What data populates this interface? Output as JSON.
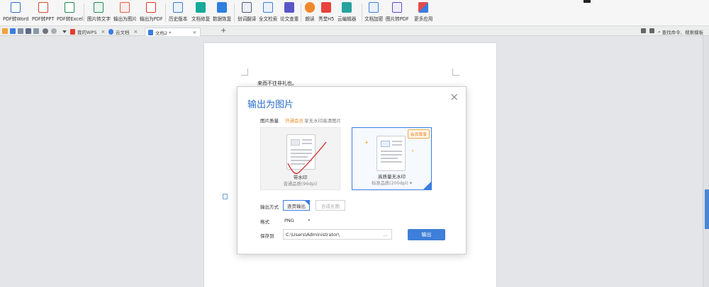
{
  "ribbon": {
    "buttons": [
      {
        "label": "PDF转Word",
        "icon": "pdf-to-word-icon",
        "color": "#2b6fc2"
      },
      {
        "label": "PDF转PPT",
        "icon": "pdf-to-ppt-icon",
        "color": "#d24726"
      },
      {
        "label": "PDF转Excel",
        "icon": "pdf-to-excel-icon",
        "color": "#1e8a4c"
      },
      {
        "label": "图片转文字",
        "icon": "image-to-text-icon",
        "color": "#2b8a5a"
      },
      {
        "label": "输出为图片",
        "icon": "export-image-icon",
        "color": "#e25b45"
      },
      {
        "label": "输出为PDF",
        "icon": "export-pdf-icon",
        "color": "#d93a2b"
      },
      {
        "label": "历史版本",
        "icon": "history-icon",
        "color": "#3a78d4"
      },
      {
        "label": "文档修复",
        "icon": "doc-repair-icon",
        "color": "#17a99a"
      },
      {
        "label": "数据恢复",
        "icon": "data-recovery-icon",
        "color": "#2f7fe0"
      },
      {
        "label": "划词翻译",
        "icon": "translate-icon",
        "color": "#4c5a7a"
      },
      {
        "label": "全文检索",
        "icon": "fulltext-search-icon",
        "color": "#3b7de0"
      },
      {
        "label": "论文查重",
        "icon": "plagiarism-check-icon",
        "color": "#5b56c8"
      },
      {
        "label": "朗读",
        "icon": "read-aloud-icon",
        "color": "#f0892b"
      },
      {
        "label": "秀堂H5",
        "icon": "h5-icon",
        "color": "#e8433c"
      },
      {
        "label": "云编辑器",
        "icon": "cloud-editor-icon",
        "color": "#27a3a0"
      },
      {
        "label": "文档加密",
        "icon": "encrypt-icon",
        "color": "#3b7de0"
      },
      {
        "label": "图片转PDF",
        "icon": "image-to-pdf-icon",
        "color": "#5a4ec8"
      },
      {
        "label": "更多应用",
        "icon": "more-apps-icon",
        "color": "#e44b4b"
      }
    ]
  },
  "tabs": {
    "items": [
      {
        "label": "我的WPS",
        "icon": "wps-logo-icon"
      },
      {
        "label": "云文档",
        "icon": "cloud-doc-icon"
      },
      {
        "label": "文档2 *",
        "icon": "document-icon"
      }
    ],
    "search_command": "查找命令、搜索模板"
  },
  "document": {
    "text": "来而不往非礼也。"
  },
  "dialog": {
    "title": "输出为图片",
    "quality_label": "图片质量",
    "open_vip": "开通会员",
    "vip_desc": "享无水印高清图片",
    "options": [
      {
        "title": "带水印",
        "subtitle": "普通品质(96dpi)"
      },
      {
        "title": "高质量无水印",
        "subtitle": "标准品质(200dpi)",
        "badge": "会员尊享"
      }
    ],
    "mode_label": "输出方式",
    "mode_options": [
      "逐页输出",
      "合成长图"
    ],
    "format_label": "格式",
    "format_value": "PNG",
    "save_label": "保存到",
    "save_path": "C:\\Users\\Administrator\\",
    "browse": "...",
    "export_button": "输出"
  },
  "colors": {
    "accent": "#3d7fd9",
    "vip_orange": "#f08a24"
  }
}
